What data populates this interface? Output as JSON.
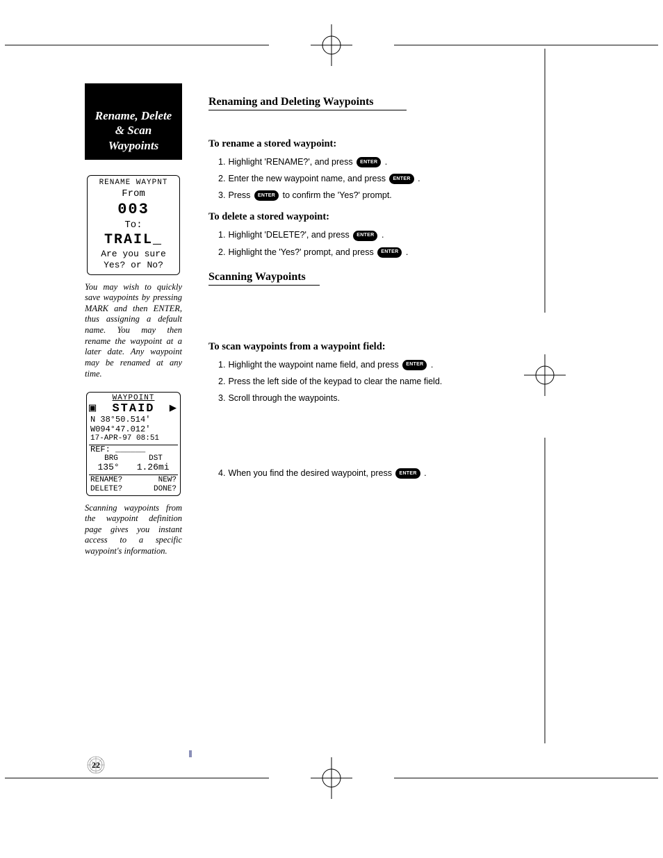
{
  "page_number": "22",
  "sidebar": {
    "title_l1": "Rename, Delete",
    "title_l2": "& Scan",
    "title_l3": "Waypoints",
    "lcd1": {
      "header": "RENAME WAYPNT",
      "from_label": "From",
      "from_value": "003",
      "to_label": "To:",
      "to_value": "TRAIL_",
      "confirm_l1": "Are you sure",
      "confirm_l2": "Yes? or No?"
    },
    "caption1": "You may wish to quickly save waypoints by pressing MARK and then ENTER, thus assigning a default name. You may then rename the waypoint at a later date. Any waypoint may be renamed at any time.",
    "lcd2": {
      "header": "WAYPOINT",
      "name": "STAID",
      "coord_n": "N  38°50.514'",
      "coord_w": "W094°47.012'",
      "date": "17-APR-97 08:51",
      "ref_label": "REF:",
      "ref_value": "______",
      "brg_label": "BRG",
      "dst_label": "DST",
      "brg_value": "135°",
      "dst_value": "1.26mi",
      "opt_rename": "RENAME?",
      "opt_new": "NEW?",
      "opt_delete": "DELETE?",
      "opt_done": "DONE?"
    },
    "caption2": "Scanning waypoints from the waypoint definition page gives you instant access to a specific waypoint's information."
  },
  "main": {
    "section1_title": "Renaming and Deleting Waypoints",
    "rename_heading": "To rename a stored waypoint:",
    "rename_steps": {
      "s1a": "Highlight 'RENAME?', and press",
      "s2a": "Enter the new waypoint name, and press",
      "s3a": "Press",
      "s3b": "to confirm the 'Yes?' prompt."
    },
    "delete_heading": "To delete a stored waypoint:",
    "delete_steps": {
      "s1a": "Highlight 'DELETE?', and press",
      "s2a": "Highlight the 'Yes?' prompt, and press"
    },
    "section2_title": "Scanning Waypoints",
    "scan_heading": "To scan waypoints from a waypoint field:",
    "scan_steps": {
      "s1a": "Highlight the waypoint name field, and press",
      "s2": "Press the left side of the keypad to clear the name field.",
      "s3": "Scroll through the waypoints.",
      "s4a": "When you find the desired waypoint, press"
    },
    "enter_label": "ENTER"
  }
}
